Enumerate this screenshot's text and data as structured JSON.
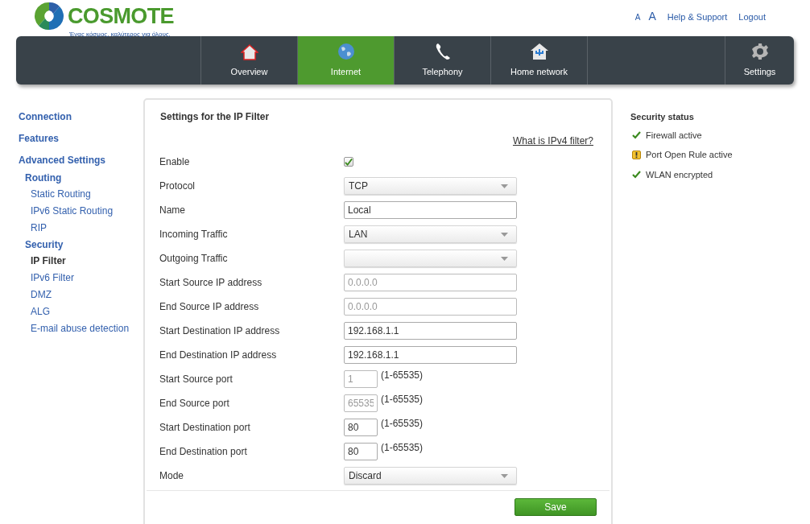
{
  "header": {
    "logo_text": "COSMOTE",
    "tagline": "Ένας κόσμος, καλύτερος για όλους.",
    "links": [
      {
        "kind": "font-small",
        "label": "A"
      },
      {
        "kind": "font-large",
        "label": "A"
      },
      {
        "kind": "link",
        "label": "Help & Support"
      },
      {
        "kind": "link",
        "label": "Logout"
      }
    ]
  },
  "nav": {
    "tabs": [
      {
        "kind": "house",
        "label": "Overview",
        "selected": false
      },
      {
        "kind": "globe",
        "label": "Internet",
        "selected": true
      },
      {
        "kind": "phone",
        "label": "Telephony",
        "selected": false
      },
      {
        "kind": "network",
        "label": "Home network",
        "selected": false
      },
      {
        "kind": "gear",
        "label": "Settings",
        "selected": false
      }
    ]
  },
  "sidebar": {
    "items": [
      {
        "label": "Connection",
        "selected": false
      },
      {
        "label": "Features",
        "selected": false
      },
      {
        "label": "Advanced Settings",
        "selected": false,
        "children": [
          {
            "label": "Routing",
            "selected": false,
            "children": [
              {
                "label": "Static Routing",
                "selected": false
              },
              {
                "label": "IPv6 Static Routing",
                "selected": false
              },
              {
                "label": "RIP",
                "selected": false
              }
            ]
          },
          {
            "label": "Security",
            "selected": false,
            "children": [
              {
                "label": "IP Filter",
                "selected": true
              },
              {
                "label": "IPv6 Filter",
                "selected": false
              },
              {
                "label": "DMZ",
                "selected": false
              },
              {
                "label": "ALG",
                "selected": false
              },
              {
                "label": "E-mail abuse detection",
                "selected": false
              }
            ]
          }
        ]
      }
    ]
  },
  "panel": {
    "title": "Settings for the IP Filter",
    "help_link": "What is IPv4 filter?",
    "fields": [
      {
        "kind": "checkbox",
        "label": "Enable",
        "checked": true
      },
      {
        "kind": "select",
        "label": "Protocol",
        "value": "TCP"
      },
      {
        "kind": "text",
        "label": "Name",
        "value": "Local",
        "disabled": false
      },
      {
        "kind": "select",
        "label": "Incoming Traffic",
        "value": "LAN"
      },
      {
        "kind": "select",
        "label": "Outgoing Traffic"
      },
      {
        "kind": "text",
        "label": "Start Source IP address",
        "value": "0.0.0.0",
        "disabled": true
      },
      {
        "kind": "text",
        "label": "End Source IP address",
        "value": "0.0.0.0",
        "disabled": true
      },
      {
        "kind": "text",
        "label": "Start Destination IP address",
        "value": "192.168.1.1",
        "disabled": false
      },
      {
        "kind": "text",
        "label": "End Destination IP address",
        "value": "192.168.1.1",
        "disabled": false
      },
      {
        "kind": "port",
        "label": "Start Source port",
        "value": "1",
        "disabled": true,
        "hint": "(1-65535)"
      },
      {
        "kind": "port",
        "label": "End Source port",
        "value": "65535",
        "disabled": true,
        "hint": "(1-65535)"
      },
      {
        "kind": "port",
        "label": "Start Destination port",
        "value": "80",
        "disabled": false,
        "hint": "(1-65535)"
      },
      {
        "kind": "port",
        "label": "End Destination port",
        "value": "80",
        "disabled": false,
        "hint": "(1-65535)"
      },
      {
        "kind": "select",
        "label": "Mode",
        "value": "Discard"
      }
    ],
    "save_button": "Save"
  },
  "security_status": {
    "title": "Security status",
    "items": [
      {
        "kind": "ok",
        "label": "Firewall active"
      },
      {
        "kind": "warning",
        "label": "Port Open Rule active"
      },
      {
        "kind": "ok",
        "label": "WLAN encrypted"
      }
    ]
  }
}
